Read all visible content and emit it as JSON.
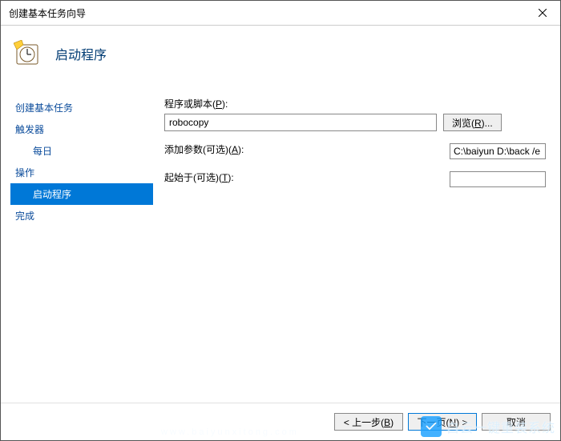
{
  "window": {
    "title": "创建基本任务向导"
  },
  "header": {
    "heading": "启动程序"
  },
  "sidebar": {
    "items": [
      {
        "label": "创建基本任务",
        "type": "item"
      },
      {
        "label": "触发器",
        "type": "item"
      },
      {
        "label": "每日",
        "type": "sub"
      },
      {
        "label": "操作",
        "type": "item"
      },
      {
        "label": "启动程序",
        "type": "sub",
        "selected": true
      },
      {
        "label": "完成",
        "type": "item"
      }
    ]
  },
  "form": {
    "program_label_prefix": "程序或脚本(",
    "program_label_u": "P",
    "program_label_suffix": "):",
    "program_value": "robocopy",
    "browse_prefix": "浏览(",
    "browse_u": "R",
    "browse_suffix": ")...",
    "args_label_prefix": "添加参数(可选)(",
    "args_label_u": "A",
    "args_label_suffix": "):",
    "args_value": "C:\\baiyun D:\\back /e",
    "startin_label_prefix": "起始于(可选)(",
    "startin_label_u": "T",
    "startin_label_suffix": "):",
    "startin_value": ""
  },
  "footer": {
    "back_prefix": "步(",
    "back_u": "B",
    "back_suffix": ")",
    "next_prefix": "下一页(",
    "next_u": "N",
    "next_suffix": ") >",
    "cancel": "取消"
  },
  "watermark": {
    "brand": "白云一键重装系统",
    "url": "www.baiyunxitong.com"
  }
}
